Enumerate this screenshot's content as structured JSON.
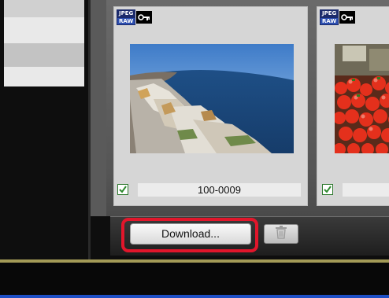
{
  "card_1": {
    "badge": {
      "line1": "JPEG",
      "line2": "RAW"
    },
    "filename": "100-0009",
    "checked": true
  },
  "card_2": {
    "badge": {
      "line1": "JPEG",
      "line2": "RAW"
    },
    "checked": true
  },
  "toolbar": {
    "download_label": "Download..."
  },
  "colors": {
    "highlight": "#e2162b",
    "accent_line": "#a39a57",
    "status_bar": "#1e4fc6"
  }
}
